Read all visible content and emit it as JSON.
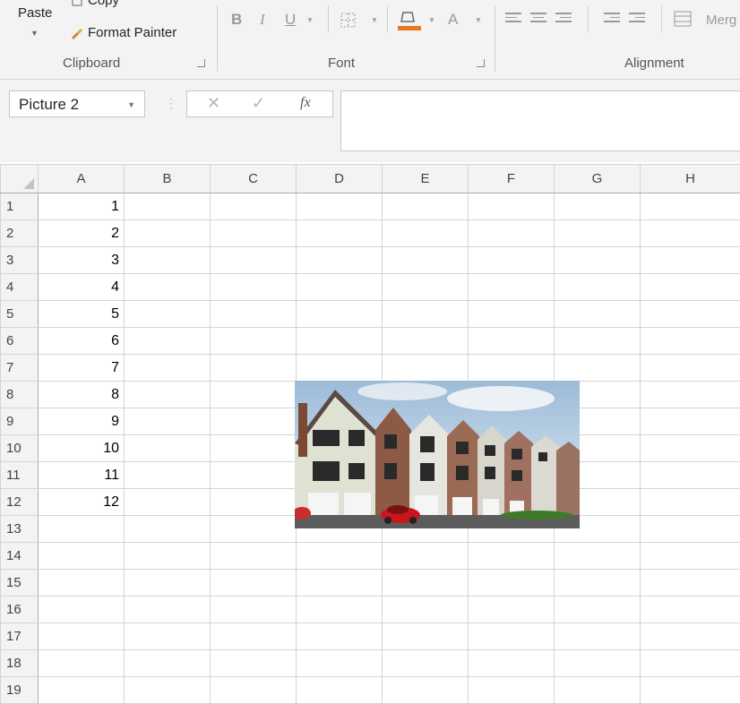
{
  "ribbon": {
    "clipboard": {
      "paste_label": "Paste",
      "copy_label": "Copy",
      "format_painter_label": "Format Painter",
      "group_label": "Clipboard"
    },
    "font": {
      "bold_label": "B",
      "italic_label": "I",
      "underline_label": "U",
      "font_color_label": "A",
      "group_label": "Font",
      "fill_color": "#e87722"
    },
    "alignment": {
      "group_label": "Alignment",
      "merge_label": "Merg"
    }
  },
  "formula_bar": {
    "name_box": "Picture 2",
    "cancel_icon": "close-icon",
    "enter_icon": "check-icon",
    "fx_label": "fx",
    "content": ""
  },
  "sheet": {
    "columns": [
      "A",
      "B",
      "C",
      "D",
      "E",
      "F",
      "G",
      "H"
    ],
    "rows": [
      {
        "row": "1",
        "a": "1"
      },
      {
        "row": "2",
        "a": "2"
      },
      {
        "row": "3",
        "a": "3"
      },
      {
        "row": "4",
        "a": "4"
      },
      {
        "row": "5",
        "a": "5"
      },
      {
        "row": "6",
        "a": "6"
      },
      {
        "row": "7",
        "a": "7"
      },
      {
        "row": "8",
        "a": "8"
      },
      {
        "row": "9",
        "a": "9"
      },
      {
        "row": "10",
        "a": "10"
      },
      {
        "row": "11",
        "a": "11"
      },
      {
        "row": "12",
        "a": "12"
      },
      {
        "row": "13",
        "a": ""
      },
      {
        "row": "14",
        "a": ""
      },
      {
        "row": "15",
        "a": ""
      },
      {
        "row": "16",
        "a": ""
      },
      {
        "row": "17",
        "a": ""
      },
      {
        "row": "18",
        "a": ""
      },
      {
        "row": "19",
        "a": ""
      }
    ]
  },
  "picture": {
    "name": "Picture 2",
    "icon": "townhouse-photo"
  }
}
